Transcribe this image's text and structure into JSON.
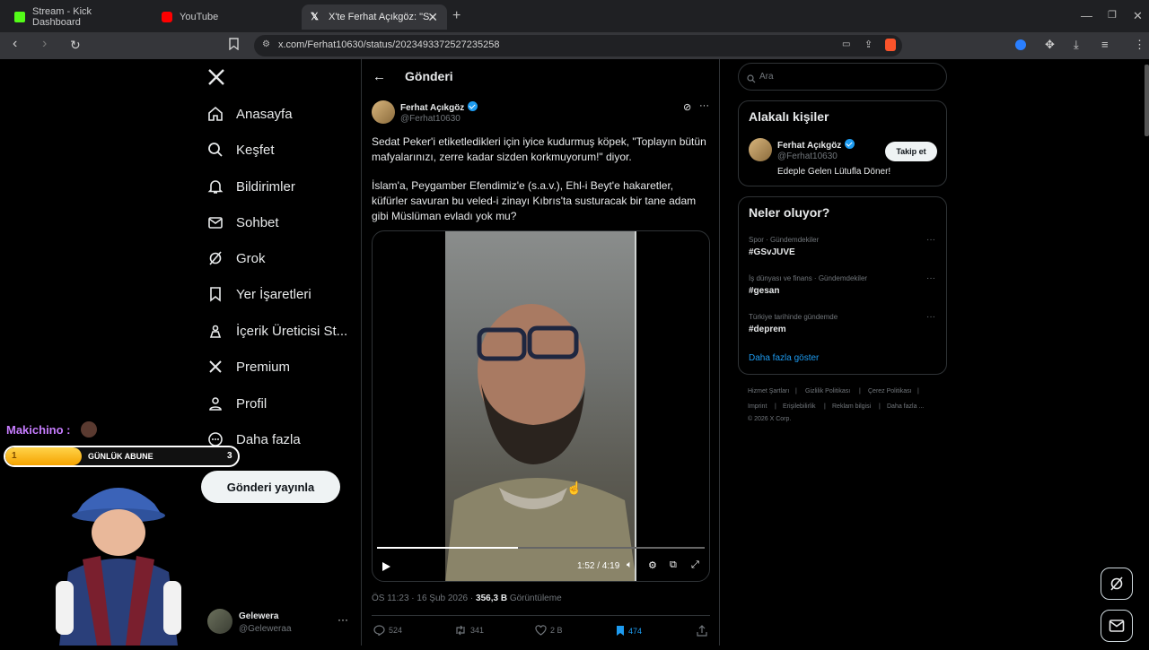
{
  "browser": {
    "tabs": [
      {
        "label": "Stream - Kick Dashboard",
        "favicon_color": "#53fc18",
        "active": false
      },
      {
        "label": "YouTube",
        "favicon_color": "#ff0000",
        "active": false
      },
      {
        "label": "X'te Ferhat Açıkgöz: \"Sedat",
        "favicon_color": "#ffffff",
        "active": true
      }
    ],
    "new_tab_icon": "plus-icon",
    "url": "x.com/Ferhat10630/status/2023493372527235258"
  },
  "nav": {
    "items": [
      {
        "label": "Anasayfa",
        "icon": "home-icon"
      },
      {
        "label": "Keşfet",
        "icon": "search-icon"
      },
      {
        "label": "Bildirimler",
        "icon": "bell-icon"
      },
      {
        "label": "Sohbet",
        "icon": "mail-icon"
      },
      {
        "label": "Grok",
        "icon": "grok-icon"
      },
      {
        "label": "Yer İşaretleri",
        "icon": "bookmark-icon"
      },
      {
        "label": "İçerik Üreticisi St...",
        "icon": "creator-icon"
      },
      {
        "label": "Premium",
        "icon": "x-icon"
      },
      {
        "label": "Profil",
        "icon": "person-icon"
      },
      {
        "label": "Daha fazla",
        "icon": "more-circle-icon"
      }
    ],
    "post_button": "Gönderi yayınla",
    "account": {
      "name": "Gelewera",
      "handle": "@Geleweraa"
    }
  },
  "post": {
    "header": "Gönderi",
    "author_name": "Ferhat Açıkgöz",
    "author_handle": "@Ferhat10630",
    "text_1": "Sedat Peker'i etiketledikleri için iyice kudurmuş köpek, \"Toplayın bütün mafyalarınızı, zerre kadar sizden korkmuyorum!\" diyor.",
    "text_2": "İslam'a, Peygamber Efendimiz'e (s.a.v.), Ehl-i Beyt'e hakaretler, küfürler savuran bu veled-i zinayı Kıbrıs'ta susturacak bir tane adam gibi Müslüman evladı yok mu?",
    "video_time": "1:52 / 4:19",
    "video_progress": 0.43,
    "timestamp": "ÖS 11:23 · 16 Şub 2026 · ",
    "views_count": "356,3 B",
    "views_label": " Görüntüleme",
    "replies": "524",
    "reposts": "341",
    "likes": "2 B",
    "bookmarks": "474",
    "accent": "#1d9bf0"
  },
  "right": {
    "search_placeholder": "Ara",
    "related_title": "Alakalı kişiler",
    "related_person": {
      "name": "Ferhat Açıkgöz",
      "handle": "@Ferhat10630",
      "bio": "Edeple Gelen Lütufla Döner!",
      "follow": "Takip et"
    },
    "trends_title": "Neler oluyor?",
    "trends": [
      {
        "meta": "Spor · Gündemdekiler",
        "name": "#GSvJUVE"
      },
      {
        "meta": "İş dünyası ve finans · Gündemdekiler",
        "name": "#gesan"
      },
      {
        "meta": "Türkiye tarihinde gündemde",
        "name": "#deprem"
      }
    ],
    "show_more": "Daha fazla göster",
    "footer": [
      "Hizmet Şartları",
      "Gizlilik Politikası",
      "Çerez Politikası",
      "Imprint",
      "Erişilebilirlik",
      "Reklam bilgisi",
      "Daha fazla ...",
      "© 2026 X Corp."
    ]
  },
  "overlay": {
    "streamer": "Makichino :",
    "bar_label": "GÜNLÜK ABUNE",
    "bar_start": "1",
    "bar_count": "3",
    "bar_progress": 0.33
  }
}
